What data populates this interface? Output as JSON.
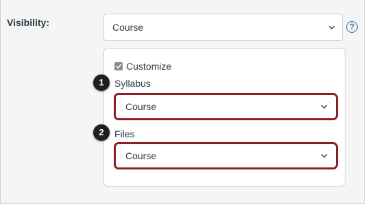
{
  "visibility": {
    "label": "Visibility:",
    "selected": "Course",
    "help_glyph": "?"
  },
  "customize": {
    "label": "Customize",
    "checked": true
  },
  "syllabus": {
    "label": "Syllabus",
    "selected": "Course",
    "callout_number": "1"
  },
  "files": {
    "label": "Files",
    "selected": "Course",
    "callout_number": "2"
  },
  "colors": {
    "highlight_border": "#8b1f24",
    "link_blue": "#2b7abc",
    "text": "#2d3b45",
    "background": "#f5f5f5"
  }
}
